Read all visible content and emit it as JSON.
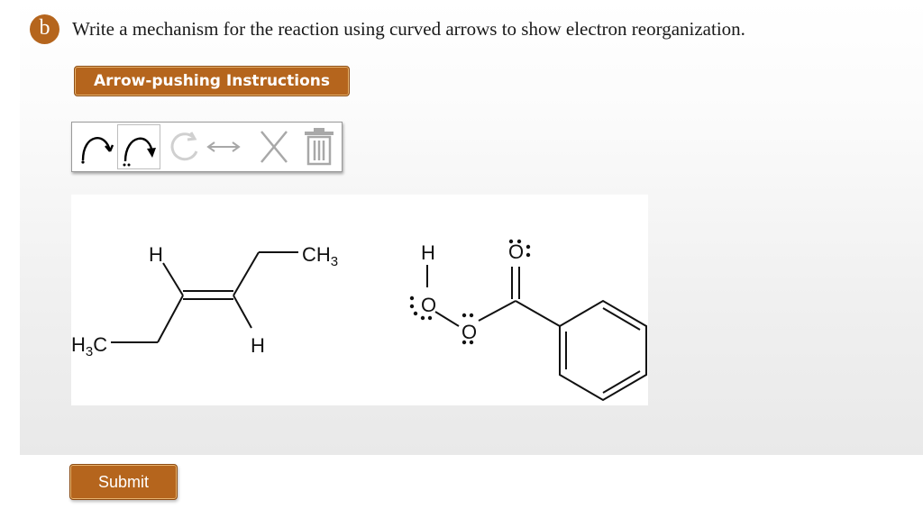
{
  "question": {
    "badge": "b",
    "text": "Write a mechanism for the reaction using curved arrows to show electron reorganization."
  },
  "instructions_button": {
    "label": "Arrow-pushing Instructions"
  },
  "toolbar": {
    "tools": [
      {
        "icon": "single-curved-arrow-icon"
      },
      {
        "icon": "double-curved-arrow-icon"
      },
      {
        "icon": "circle-arrow-icon"
      },
      {
        "icon": "resonance-arrow-icon"
      },
      {
        "icon": "delete-x-icon"
      },
      {
        "icon": "trash-icon"
      }
    ]
  },
  "molecules": {
    "alkene": {
      "h_top": "H",
      "ch3_right": {
        "main": "CH",
        "sub": "3"
      },
      "h3c_left": {
        "main": "H",
        "sub": "3",
        "tail": "C"
      },
      "h_bottom": "H"
    },
    "peracid": {
      "h_label": "H",
      "o_hydroxyl": "O",
      "o_peroxy": "O",
      "o_carbonyl": "O"
    }
  },
  "submit_button": {
    "label": "Submit"
  }
}
